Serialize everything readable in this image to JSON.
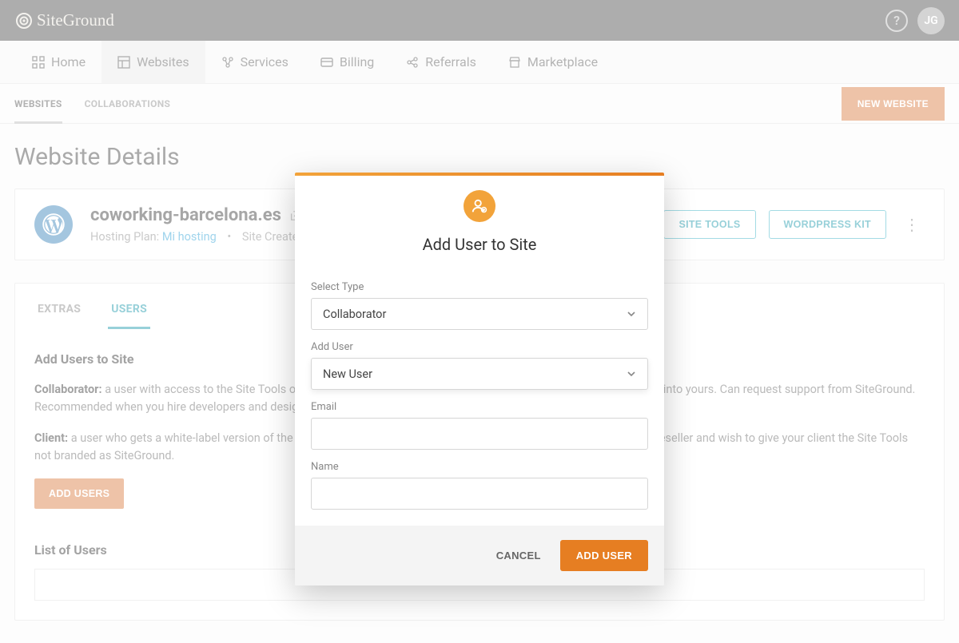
{
  "brand": "SiteGround",
  "topbar": {
    "avatar_initials": "JG"
  },
  "nav": {
    "items": [
      {
        "label": "Home"
      },
      {
        "label": "Websites"
      },
      {
        "label": "Services"
      },
      {
        "label": "Billing"
      },
      {
        "label": "Referrals"
      },
      {
        "label": "Marketplace"
      }
    ]
  },
  "subnav": {
    "tabs": [
      {
        "label": "WEBSITES"
      },
      {
        "label": "COLLABORATIONS"
      }
    ],
    "new_website_label": "NEW WEBSITE"
  },
  "page": {
    "title": "Website Details",
    "site": {
      "domain": "coworking-barcelona.es",
      "hosting_label": "Hosting Plan:",
      "hosting_plan": "Mi hosting",
      "created_label": "Site Created: D",
      "site_tools_label": "SITE TOOLS",
      "wp_kit_label": "WORDPRESS KIT"
    },
    "tools_tabs": [
      {
        "label": "EXTRAS"
      },
      {
        "label": "USERS"
      }
    ],
    "add_users_title": "Add Users to Site",
    "collab_label": "Collaborator:",
    "collab_text": " a user with access to the Site Tools of your website, who has their own SiteGround account and does not log into yours. Can request support from SiteGround. Recommended when you hire developers and designers to collaborate on your site.",
    "client_label": "Client:",
    "client_text": " a user who gets a white-label version of the Site Tools and cannot contact SiteGround. Recommended if you are a reseller and wish to give your client the Site Tools not branded as SiteGround.",
    "add_users_btn": "ADD USERS",
    "list_title": "List of Users"
  },
  "modal": {
    "title": "Add User to Site",
    "select_type_label": "Select Type",
    "select_type_value": "Collaborator",
    "add_user_label": "Add User",
    "add_user_value": "New User",
    "email_label": "Email",
    "name_label": "Name",
    "cancel": "CANCEL",
    "submit": "ADD USER"
  }
}
